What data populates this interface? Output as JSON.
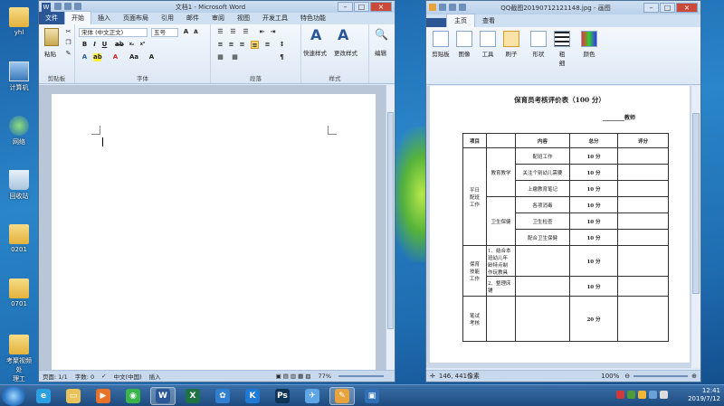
{
  "desktop": {
    "icons": [
      {
        "label": "yhl",
        "icon": "user-folder-icon"
      },
      {
        "label": "计算机",
        "icon": "computer-icon"
      },
      {
        "label": "网络",
        "icon": "network-icon"
      },
      {
        "label": "回收站",
        "icon": "recycle-bin-icon"
      },
      {
        "label": "0201",
        "icon": "folder-icon"
      },
      {
        "label": "0701",
        "icon": "folder-icon"
      },
      {
        "label": "考聚视频处\n理工",
        "icon": "folder-icon"
      }
    ]
  },
  "word": {
    "title": "文档1 - Microsoft Word",
    "tabs": [
      "文件",
      "开始",
      "插入",
      "页面布局",
      "引用",
      "邮件",
      "审阅",
      "视图",
      "开发工具",
      "特色功能"
    ],
    "ribbon": {
      "paste_label": "粘贴",
      "clipboard_label": "剪贴板",
      "font_name": "宋体 (中文正文)",
      "font_size": "五号",
      "font_group_label": "字体",
      "paragraph_label": "段落",
      "quick_styles_label": "快速样式",
      "change_styles_label": "更改样式",
      "styles_label": "样式",
      "edit_label": "编辑"
    },
    "status": {
      "page": "页面: 1/1",
      "words": "字数: 0",
      "language": "中文(中国)",
      "insert": "插入",
      "zoom": "77%"
    }
  },
  "paint": {
    "title": "QQ截图20190712121148.jpg - 画图",
    "tabs": [
      "主页",
      "查看"
    ],
    "tools": [
      "剪贴板",
      "图像",
      "工具",
      "刷子",
      "形状",
      "粗\n细",
      "颜色"
    ],
    "status": {
      "coords": "146, 441像素",
      "zoom": "100%"
    },
    "document": {
      "title": "保育员考核评价表（100 分）",
      "teacher_line": "________教师",
      "headers": [
        "项目",
        "内容",
        "总分",
        "评分"
      ],
      "rows": [
        {
          "c0": "平日\n配班\n工作",
          "c1": "教育教学",
          "c2": "配班工作",
          "c3": "10 分"
        },
        {
          "c2": "关注个别幼儿需要",
          "c3": "10 分"
        },
        {
          "c2": "上缴教育笔记",
          "c3": "10 分"
        },
        {
          "c1": "卫生保健",
          "c2": "各项消毒",
          "c3": "10 分"
        },
        {
          "c2": "卫生检查",
          "c3": "10 分"
        },
        {
          "c2": "配合卫生保健",
          "c3": "10 分"
        },
        {
          "c0": "保育\n技能\n工作",
          "c1": "1、结合本\n班幼儿年\n龄特点制\n作玩教具",
          "c3": "10 分"
        },
        {
          "c1": "2、整理床\n铺",
          "c3": "10 分"
        },
        {
          "c0": "笔试\n考核",
          "c3": "20 分"
        }
      ]
    }
  },
  "taskbar": {
    "apps": [
      {
        "name": "ie-icon",
        "glyph": "e",
        "color": "#2aa0e0"
      },
      {
        "name": "explorer-icon",
        "glyph": "▭",
        "color": "#e8c35a"
      },
      {
        "name": "media-player-icon",
        "glyph": "▶",
        "color": "#e9722b"
      },
      {
        "name": "green-app-icon",
        "glyph": "◉",
        "color": "#39b54a"
      },
      {
        "name": "word-icon",
        "glyph": "W",
        "color": "#2b5797"
      },
      {
        "name": "excel-icon",
        "glyph": "X",
        "color": "#1f7244"
      },
      {
        "name": "qq-icon",
        "glyph": "✿",
        "color": "#2f80d1"
      },
      {
        "name": "kugou-icon",
        "glyph": "K",
        "color": "#1f7ad6"
      },
      {
        "name": "photoshop-icon",
        "glyph": "Ps",
        "color": "#0f3556"
      },
      {
        "name": "bird-icon",
        "glyph": "✈",
        "color": "#5fa6e6"
      },
      {
        "name": "paint-icon",
        "glyph": "✎",
        "color": "#e8a43c"
      },
      {
        "name": "screen-recorder-icon",
        "glyph": "▣",
        "color": "#2e6fb5"
      }
    ],
    "time": "12:41",
    "date": "2019/7/12"
  }
}
